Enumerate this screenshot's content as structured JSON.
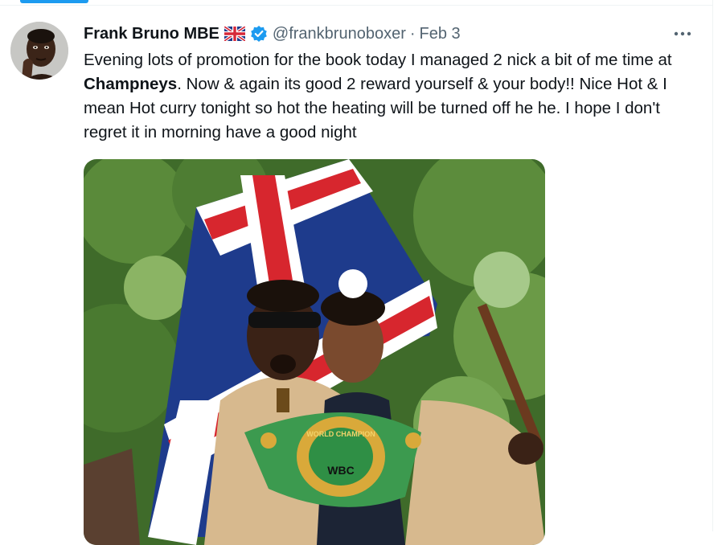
{
  "tweet": {
    "author_name": "Frank Bruno MBE",
    "flag_icon": "uk-flag-emoji",
    "verified_icon": "verified-badge-icon",
    "handle": "@frankbrunoboxer",
    "separator": "·",
    "date": "Feb 3",
    "text_part1": "Evening lots of promotion for the book today I managed 2 nick a bit of me time at ",
    "text_bold": "Champneys",
    "text_part2": ". Now & again its good 2 reward yourself & your body!! Nice Hot & I mean Hot curry tonight so hot the heating will be turned off he he. I hope I don't regret it in morning have a good night",
    "more_icon": "more-options-icon",
    "media": {
      "belt_top_text": "WORLD CHAMPION",
      "belt_label": "WBC"
    }
  },
  "colors": {
    "accent": "#1d9bf0",
    "secondary_text": "#536471",
    "primary_text": "#0f1419",
    "verified": "#1d9bf0"
  }
}
